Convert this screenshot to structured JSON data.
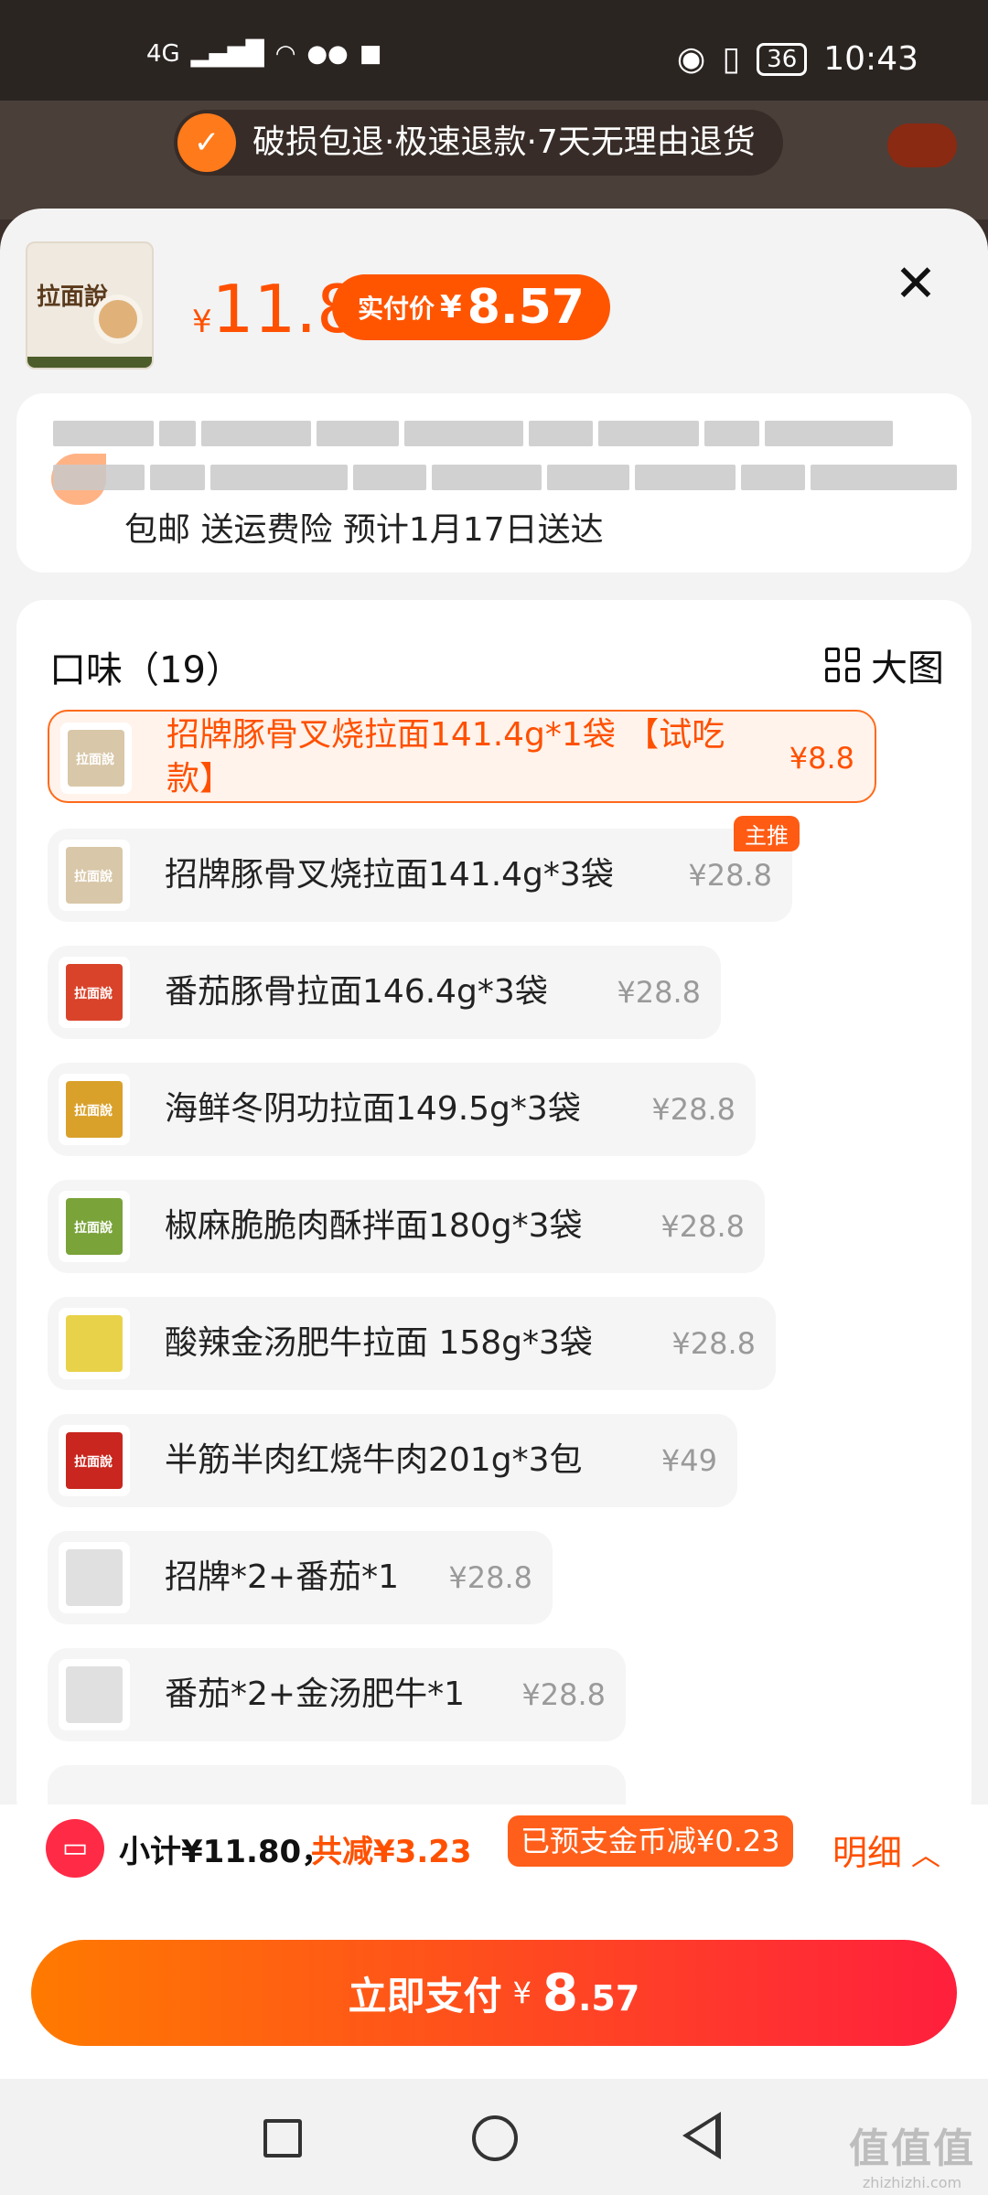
{
  "status": {
    "network": "4G",
    "battery": "36",
    "time": "10:43"
  },
  "promo": {
    "text": "破损包退·极速退款·7天无理由退货"
  },
  "product": {
    "thumb_title": "拉面說",
    "price_currency": "¥",
    "price": "11.8",
    "paid_label": "实付价",
    "paid_currency": "¥",
    "paid_value": "8.57"
  },
  "shipping": {
    "text": "包邮 送运费险 预计1月17日送达"
  },
  "options": {
    "title": "口味（19）",
    "big_view_label": "大图",
    "main_tag": "主推",
    "items": [
      {
        "name": "招牌豚骨叉烧拉面141.4g*1袋 【试吃款】",
        "price": "¥8.8",
        "color": "#d8c7a8"
      },
      {
        "name": "招牌豚骨叉烧拉面141.4g*3袋",
        "price": "¥28.8",
        "color": "#d8c7a8"
      },
      {
        "name": "番茄豚骨拉面146.4g*3袋",
        "price": "¥28.8",
        "color": "#d9432a"
      },
      {
        "name": "海鲜冬阴功拉面149.5g*3袋",
        "price": "¥28.8",
        "color": "#d9a12a"
      },
      {
        "name": "椒麻脆脆肉酥拌面180g*3袋",
        "price": "¥28.8",
        "color": "#7aa33a"
      },
      {
        "name": "酸辣金汤肥牛拉面 158g*3袋",
        "price": "¥28.8",
        "color": "#e8d24a"
      },
      {
        "name": "半筋半肉红烧牛肉201g*3包",
        "price": "¥49",
        "color": "#c8261e"
      },
      {
        "name": "招牌*2+番茄*1",
        "price": "¥28.8",
        "color": "#e0e0e0"
      },
      {
        "name": "番茄*2+金汤肥牛*1",
        "price": "¥28.8",
        "color": "#e0e0e0"
      }
    ]
  },
  "summary": {
    "subtotal": "小计¥11.80，",
    "reduce": "共减¥3.23",
    "coin": "已预支金币减¥0.23",
    "detail": "明细"
  },
  "pay": {
    "label": "立即支付",
    "currency": "¥",
    "int": "8",
    "dec": ".57"
  },
  "watermark": {
    "line1": "值值值",
    "line2": "zhizhizhi.com"
  }
}
